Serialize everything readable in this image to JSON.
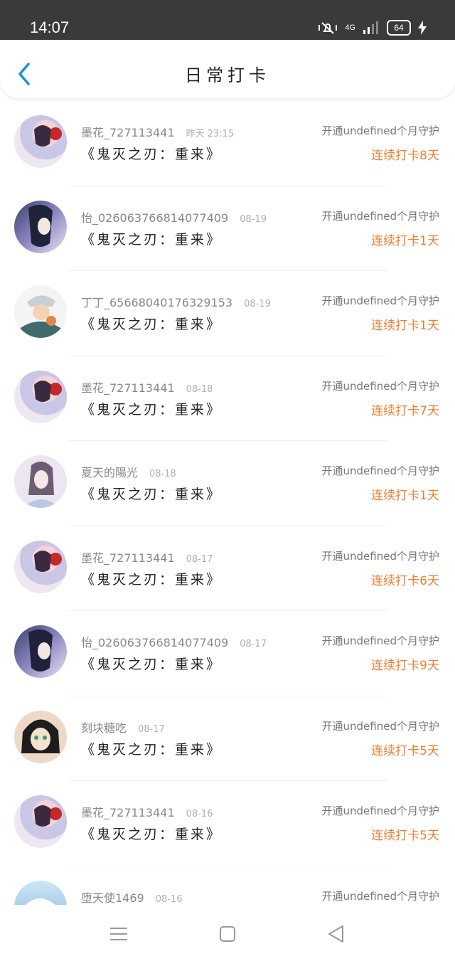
{
  "status_bar": {
    "time": "14:07",
    "network": "4G",
    "battery": "64"
  },
  "header": {
    "title": "日常打卡"
  },
  "rows": [
    {
      "name": "墨花_727113441",
      "date": "昨天 23:15",
      "book": "《鬼灭之刃：重来》",
      "vip": "开通undefined个月守护",
      "streak": "连续打卡8天"
    },
    {
      "name": "怡_026063766814077409",
      "date": "08-19",
      "book": "《鬼灭之刃：重来》",
      "vip": "开通undefined个月守护",
      "streak": "连续打卡1天"
    },
    {
      "name": "丁丁_65668040176329153",
      "date": "08-19",
      "book": "《鬼灭之刃：重来》",
      "vip": "开通undefined个月守护",
      "streak": "连续打卡1天"
    },
    {
      "name": "墨花_727113441",
      "date": "08-18",
      "book": "《鬼灭之刃：重来》",
      "vip": "开通undefined个月守护",
      "streak": "连续打卡7天"
    },
    {
      "name": "夏天的陽光",
      "date": "08-18",
      "book": "《鬼灭之刃：重来》",
      "vip": "开通undefined个月守护",
      "streak": "连续打卡1天"
    },
    {
      "name": "墨花_727113441",
      "date": "08-17",
      "book": "《鬼灭之刃：重来》",
      "vip": "开通undefined个月守护",
      "streak": "连续打卡6天"
    },
    {
      "name": "怡_026063766814077409",
      "date": "08-17",
      "book": "《鬼灭之刃：重来》",
      "vip": "开通undefined个月守护",
      "streak": "连续打卡9天"
    },
    {
      "name": "刻块糖吃",
      "date": "08-17",
      "book": "《鬼灭之刃：重来》",
      "vip": "开通undefined个月守护",
      "streak": "连续打卡5天"
    },
    {
      "name": "墨花_727113441",
      "date": "08-16",
      "book": "《鬼灭之刃：重来》",
      "vip": "开通undefined个月守护",
      "streak": "连续打卡5天"
    },
    {
      "name": "堕天使1469",
      "date": "08-16",
      "book": "",
      "vip": "开通undefined个月守护",
      "streak": ""
    }
  ],
  "colors": {
    "accent": "#1e90e0",
    "streak": "#f07f32"
  }
}
